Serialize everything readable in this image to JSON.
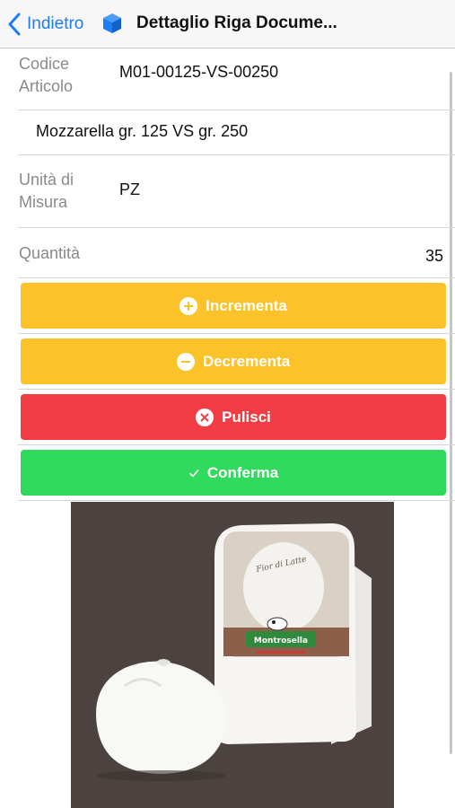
{
  "nav": {
    "back_label": "Indietro",
    "title": "Dettaglio Riga Docume..."
  },
  "fields": {
    "codice_label": "Codice\nArticolo",
    "codice_value": "M01-00125-VS-00250",
    "description": "Mozzarella gr. 125 VS gr. 250",
    "um_label": "Unità di\nMisura",
    "um_value": "PZ",
    "qty_label": "Quantità",
    "qty_value": "35"
  },
  "buttons": {
    "incrementa": "Incrementa",
    "decrementa": "Decrementa",
    "pulisci": "Pulisci",
    "conferma": "Conferma"
  },
  "image": {
    "brand_text": "Montrosella"
  },
  "colors": {
    "accent": "#1e7cf5",
    "warning": "#fcc22a",
    "danger": "#f23c44",
    "success": "#2fda5c"
  }
}
